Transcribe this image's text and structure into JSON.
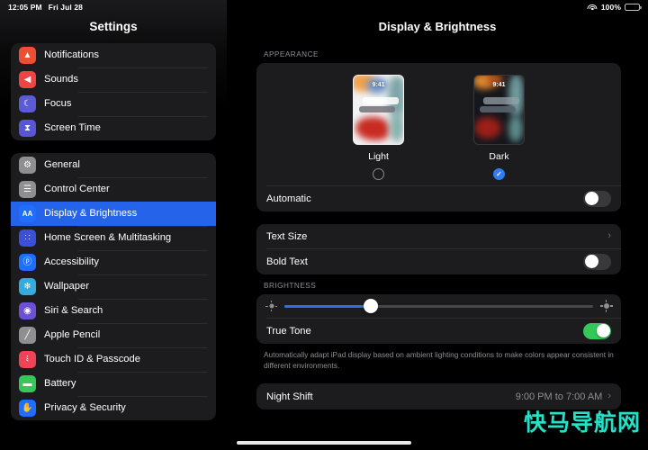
{
  "status_bar": {
    "time": "12:05 PM",
    "date": "Fri Jul 28",
    "wifi_icon": "wifi-icon",
    "battery_percent": "100%",
    "battery_icon": "battery-icon"
  },
  "sidebar": {
    "title": "Settings",
    "groups": [
      {
        "items": [
          {
            "label": "Notifications",
            "icon": "bell-icon",
            "icon_glyph": "▲",
            "icon_color": "#ee4f32",
            "selected": false
          },
          {
            "label": "Sounds",
            "icon": "speaker-icon",
            "icon_glyph": "◀",
            "icon_color": "#ef4444",
            "selected": false
          },
          {
            "label": "Focus",
            "icon": "moon-icon",
            "icon_glyph": "☾",
            "icon_color": "#5b5bd6",
            "selected": false
          },
          {
            "label": "Screen Time",
            "icon": "hourglass-icon",
            "icon_glyph": "⧗",
            "icon_color": "#5856d6",
            "selected": false
          }
        ]
      },
      {
        "items": [
          {
            "label": "General",
            "icon": "gear-icon",
            "icon_glyph": "⚙",
            "icon_color": "#8e8e93",
            "selected": false
          },
          {
            "label": "Control Center",
            "icon": "sliders-icon",
            "icon_glyph": "☰",
            "icon_color": "#8e8e93",
            "selected": false
          },
          {
            "label": "Display & Brightness",
            "icon": "text-size-icon",
            "icon_glyph": "AA",
            "icon_color": "#1e6fff",
            "selected": true
          },
          {
            "label": "Home Screen & Multitasking",
            "icon": "grid-icon",
            "icon_glyph": "∷",
            "icon_color": "#3b4fd8",
            "selected": false
          },
          {
            "label": "Accessibility",
            "icon": "person-icon",
            "icon_glyph": "ⓟ",
            "icon_color": "#1e6fff",
            "selected": false
          },
          {
            "label": "Wallpaper",
            "icon": "flower-icon",
            "icon_glyph": "❄",
            "icon_color": "#35aadc",
            "selected": false
          },
          {
            "label": "Siri & Search",
            "icon": "siri-icon",
            "icon_glyph": "◉",
            "icon_color": "#6e4fd8",
            "selected": false
          },
          {
            "label": "Apple Pencil",
            "icon": "pencil-icon",
            "icon_glyph": "╱",
            "icon_color": "#8e8e93",
            "selected": false
          },
          {
            "label": "Touch ID & Passcode",
            "icon": "fingerprint-icon",
            "icon_glyph": "༴",
            "icon_color": "#ef4356",
            "selected": false
          },
          {
            "label": "Battery",
            "icon": "battery-icon",
            "icon_glyph": "▬",
            "icon_color": "#34c759",
            "selected": false
          },
          {
            "label": "Privacy & Security",
            "icon": "hand-icon",
            "icon_glyph": "✋",
            "icon_color": "#1e6fff",
            "selected": false
          }
        ]
      }
    ]
  },
  "main": {
    "title": "Display & Brightness",
    "appearance": {
      "header": "APPEARANCE",
      "options": [
        {
          "label": "Light",
          "selected": false,
          "wallpaper_time": "9:41",
          "theme": "light"
        },
        {
          "label": "Dark",
          "selected": true,
          "wallpaper_time": "9:41",
          "theme": "dark"
        }
      ],
      "check_glyph": "✓",
      "automatic": {
        "label": "Automatic",
        "enabled": false
      }
    },
    "text_section": {
      "text_size": {
        "label": "Text Size",
        "chevron": "›"
      },
      "bold_text": {
        "label": "Bold Text",
        "enabled": false
      }
    },
    "brightness": {
      "header": "BRIGHTNESS",
      "slider": {
        "value_percent": 28,
        "low_icon": "brightness-low-icon",
        "high_icon": "brightness-high-icon"
      },
      "true_tone": {
        "label": "True Tone",
        "enabled": true
      },
      "footnote": "Automatically adapt iPad display based on ambient lighting conditions to make colors appear consistent in different environments."
    },
    "night_shift": {
      "label": "Night Shift",
      "value": "9:00 PM to 7:00 AM",
      "chevron": "›"
    }
  },
  "watermark": {
    "text": "快马导航网",
    "color": "#27e0c8"
  }
}
